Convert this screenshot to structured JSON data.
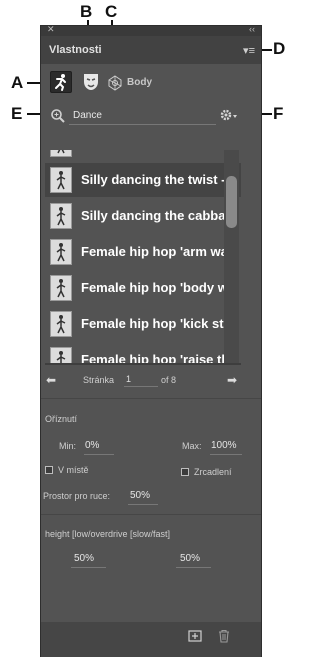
{
  "callouts": {
    "a": "A",
    "b": "B",
    "c": "C",
    "d": "D",
    "e": "E",
    "f": "F"
  },
  "panel": {
    "title": "Vlastnosti",
    "close_glyph": "✕",
    "collapse_glyph": "‹‹",
    "menu_glyph": "▾≡"
  },
  "tabs": {
    "active_icon": "dancing-figure-icon",
    "body_label": "Body"
  },
  "search": {
    "value": "Dance",
    "gear_glyph": "⚙▾"
  },
  "list": [
    {
      "label": ""
    },
    {
      "label": "Silly dancing the twist -"
    },
    {
      "label": "Silly dancing the cabbag"
    },
    {
      "label": "Female hip hop 'arm wa"
    },
    {
      "label": "Female hip hop 'body w"
    },
    {
      "label": "Female hip hop 'kick ste"
    },
    {
      "label": "Female hip hop 'raise th"
    }
  ],
  "pager": {
    "prev": "⬅",
    "next": "➡",
    "label": "Stránka",
    "page": "1",
    "of": "of 8"
  },
  "trim": {
    "heading": "Oříznutí",
    "min_label": "Min:",
    "min_value": "0%",
    "max_label": "Max:",
    "max_value": "100%",
    "in_place": "V místě",
    "mirror": "Zrcadlení"
  },
  "hand_space": {
    "label": "Prostor pro ruce:",
    "value": "50%"
  },
  "height": {
    "heading": "height [low/overdrive [slow/fast]",
    "left": "50%",
    "right": "50%"
  }
}
